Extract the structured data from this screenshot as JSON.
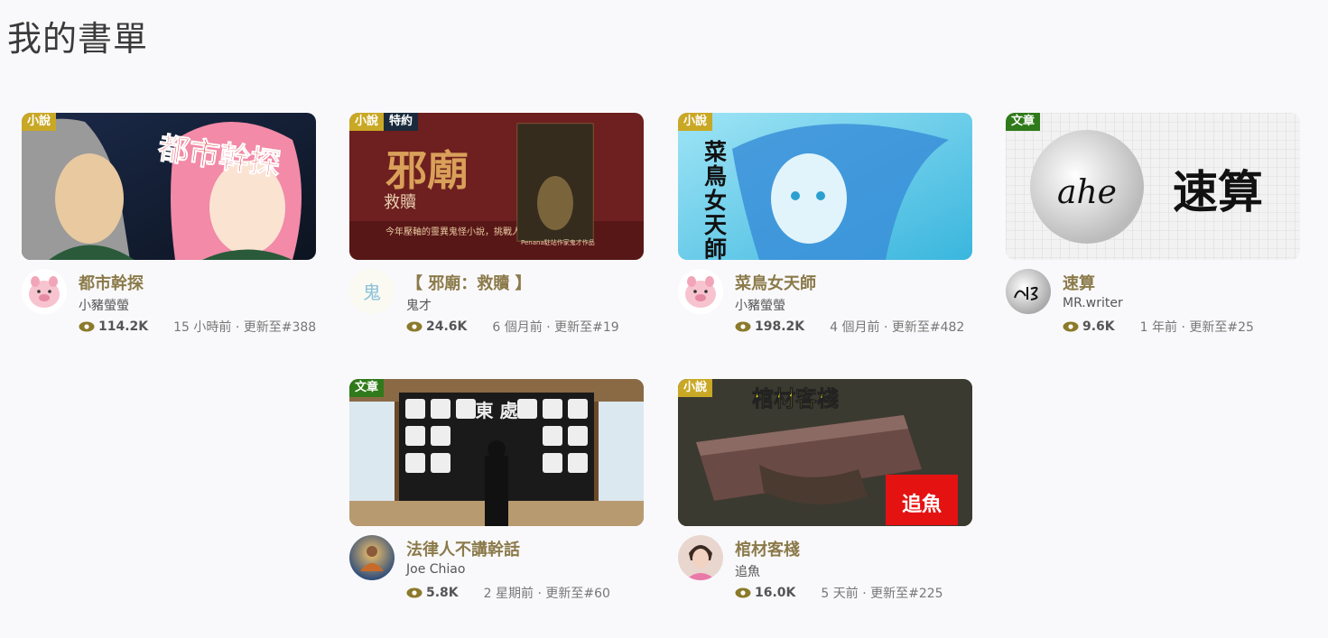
{
  "page": {
    "title": "我的書單"
  },
  "books": [
    {
      "tags": [
        "小說"
      ],
      "cover_text": "都市幹探",
      "title": "都市幹探",
      "author": "小豬螢螢",
      "views": "114.2K",
      "update": "15 小時前 · 更新至#388",
      "avatar_icon": "pig-avatar-icon"
    },
    {
      "tags": [
        "小說",
        "特約"
      ],
      "cover_text": "邪廟",
      "cover_sub": "救贖",
      "cover_caption": "今年壓軸的靈異鬼怪小說，挑戰人性的極限",
      "cover_small": "Penana駐站作家鬼才作品",
      "title": "【 邪廟：救贖 】",
      "author": "鬼才",
      "views": "24.6K",
      "update": "6 個月前 · 更新至#19",
      "avatar_icon": "ghost-logo-icon",
      "avatar_text": "鬼"
    },
    {
      "tags": [
        "小說"
      ],
      "cover_text": "菜鳥女天師",
      "title": "菜鳥女天師",
      "author": "小豬螢螢",
      "views": "198.2K",
      "update": "4 個月前 · 更新至#482",
      "avatar_icon": "pig-avatar-icon"
    },
    {
      "tags": [
        "文章"
      ],
      "cover_text": "速算",
      "cover_logo": "ahe",
      "title": "速算",
      "author": "MR.writer",
      "views": "9.6K",
      "update": "1 年前 · 更新至#25",
      "avatar_icon": "ahe-logo-icon"
    },
    {
      "tags": [
        "文章"
      ],
      "cover_text": "東 處",
      "title": "法律人不講幹話",
      "author": "Joe Chiao",
      "views": "5.8K",
      "update": "2 星期前 · 更新至#60",
      "avatar_icon": "meditation-avatar-icon"
    },
    {
      "tags": [
        "小說"
      ],
      "cover_text": "棺材客棧",
      "cover_badge": "追魚",
      "title": "棺材客棧",
      "author": "追魚",
      "views": "16.0K",
      "update": "5 天前 · 更新至#225",
      "avatar_icon": "person-avatar-icon"
    }
  ],
  "colors": {
    "tag_novel": "#c9a825",
    "tag_article": "#2f7a1a",
    "tag_special": "#1b2b3d",
    "title": "#8b7a4a",
    "eye": "#8b7a2a"
  }
}
